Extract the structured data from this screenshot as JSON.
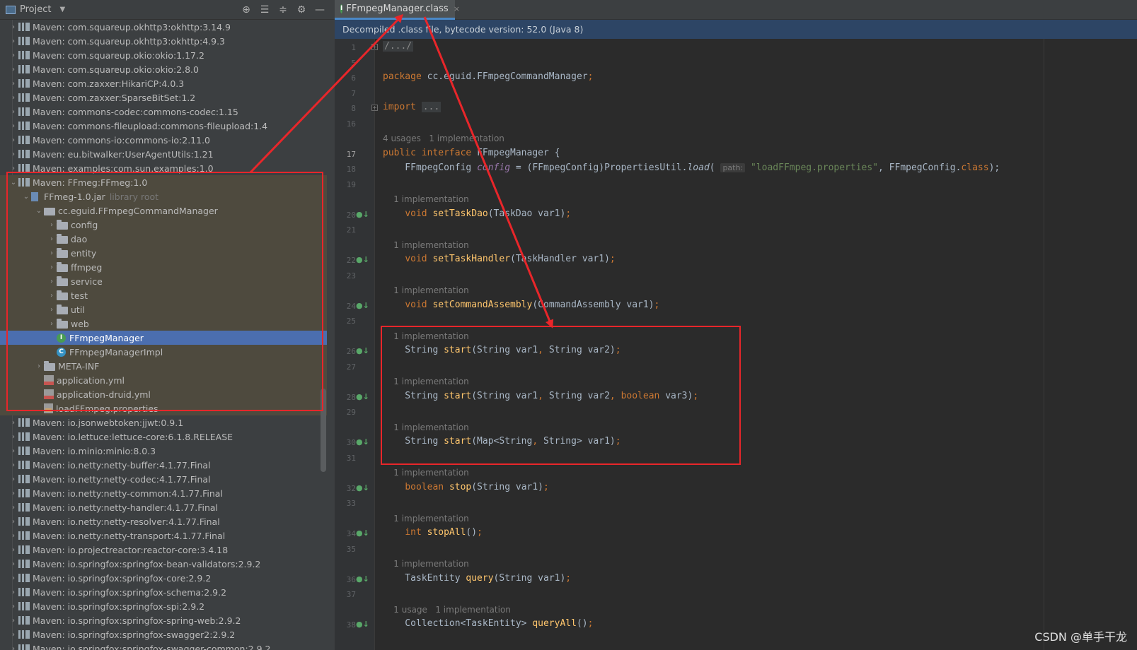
{
  "project_panel": {
    "title": "Project",
    "tools": [
      "locate-icon",
      "expand-all-icon",
      "collapse-all-icon",
      "gear-icon",
      "minimize-icon"
    ],
    "tree": [
      {
        "label": "Maven: com.squareup.okhttp3:okhttp:3.14.9",
        "kind": "lib",
        "depth": 0,
        "expanded": false
      },
      {
        "label": "Maven: com.squareup.okhttp3:okhttp:4.9.3",
        "kind": "lib",
        "depth": 0,
        "expanded": false
      },
      {
        "label": "Maven: com.squareup.okio:okio:1.17.2",
        "kind": "lib",
        "depth": 0,
        "expanded": false
      },
      {
        "label": "Maven: com.squareup.okio:okio:2.8.0",
        "kind": "lib",
        "depth": 0,
        "expanded": false
      },
      {
        "label": "Maven: com.zaxxer:HikariCP:4.0.3",
        "kind": "lib",
        "depth": 0,
        "expanded": false
      },
      {
        "label": "Maven: com.zaxxer:SparseBitSet:1.2",
        "kind": "lib",
        "depth": 0,
        "expanded": false
      },
      {
        "label": "Maven: commons-codec:commons-codec:1.15",
        "kind": "lib",
        "depth": 0,
        "expanded": false
      },
      {
        "label": "Maven: commons-fileupload:commons-fileupload:1.4",
        "kind": "lib",
        "depth": 0,
        "expanded": false
      },
      {
        "label": "Maven: commons-io:commons-io:2.11.0",
        "kind": "lib",
        "depth": 0,
        "expanded": false
      },
      {
        "label": "Maven: eu.bitwalker:UserAgentUtils:1.21",
        "kind": "lib",
        "depth": 0,
        "expanded": false
      },
      {
        "label": "Maven: examples:com.sun.examples:1.0",
        "kind": "lib",
        "depth": 0,
        "expanded": false
      },
      {
        "label": "Maven: FFmeg:FFmeg:1.0",
        "kind": "lib",
        "depth": 0,
        "expanded": true
      },
      {
        "label": "FFmeg-1.0.jar",
        "suffix": "library root",
        "kind": "jar",
        "depth": 1,
        "expanded": true
      },
      {
        "label": "cc.eguid.FFmpegCommandManager",
        "kind": "pkg",
        "depth": 2,
        "expanded": true
      },
      {
        "label": "config",
        "kind": "folder",
        "depth": 3,
        "expanded": false
      },
      {
        "label": "dao",
        "kind": "folder",
        "depth": 3,
        "expanded": false
      },
      {
        "label": "entity",
        "kind": "folder",
        "depth": 3,
        "expanded": false
      },
      {
        "label": "ffmpeg",
        "kind": "folder",
        "depth": 3,
        "expanded": false
      },
      {
        "label": "service",
        "kind": "folder",
        "depth": 3,
        "expanded": false
      },
      {
        "label": "test",
        "kind": "folder",
        "depth": 3,
        "expanded": false
      },
      {
        "label": "util",
        "kind": "folder",
        "depth": 3,
        "expanded": false
      },
      {
        "label": "web",
        "kind": "folder",
        "depth": 3,
        "expanded": false
      },
      {
        "label": "FFmpegManager",
        "kind": "interface",
        "depth": 3,
        "selected": true
      },
      {
        "label": "FFmpegManagerImpl",
        "kind": "class",
        "depth": 3
      },
      {
        "label": "META-INF",
        "kind": "folder",
        "depth": 2,
        "expanded": false
      },
      {
        "label": "application.yml",
        "kind": "yml",
        "depth": 2
      },
      {
        "label": "application-druid.yml",
        "kind": "yml",
        "depth": 2
      },
      {
        "label": "loadFFmpeg.properties",
        "kind": "prop",
        "depth": 2
      },
      {
        "label": "Maven: io.jsonwebtoken:jjwt:0.9.1",
        "kind": "lib",
        "depth": 0,
        "expanded": false
      },
      {
        "label": "Maven: io.lettuce:lettuce-core:6.1.8.RELEASE",
        "kind": "lib",
        "depth": 0,
        "expanded": false
      },
      {
        "label": "Maven: io.minio:minio:8.0.3",
        "kind": "lib",
        "depth": 0,
        "expanded": false
      },
      {
        "label": "Maven: io.netty:netty-buffer:4.1.77.Final",
        "kind": "lib",
        "depth": 0,
        "expanded": false
      },
      {
        "label": "Maven: io.netty:netty-codec:4.1.77.Final",
        "kind": "lib",
        "depth": 0,
        "expanded": false
      },
      {
        "label": "Maven: io.netty:netty-common:4.1.77.Final",
        "kind": "lib",
        "depth": 0,
        "expanded": false
      },
      {
        "label": "Maven: io.netty:netty-handler:4.1.77.Final",
        "kind": "lib",
        "depth": 0,
        "expanded": false
      },
      {
        "label": "Maven: io.netty:netty-resolver:4.1.77.Final",
        "kind": "lib",
        "depth": 0,
        "expanded": false
      },
      {
        "label": "Maven: io.netty:netty-transport:4.1.77.Final",
        "kind": "lib",
        "depth": 0,
        "expanded": false
      },
      {
        "label": "Maven: io.projectreactor:reactor-core:3.4.18",
        "kind": "lib",
        "depth": 0,
        "expanded": false
      },
      {
        "label": "Maven: io.springfox:springfox-bean-validators:2.9.2",
        "kind": "lib",
        "depth": 0,
        "expanded": false
      },
      {
        "label": "Maven: io.springfox:springfox-core:2.9.2",
        "kind": "lib",
        "depth": 0,
        "expanded": false
      },
      {
        "label": "Maven: io.springfox:springfox-schema:2.9.2",
        "kind": "lib",
        "depth": 0,
        "expanded": false
      },
      {
        "label": "Maven: io.springfox:springfox-spi:2.9.2",
        "kind": "lib",
        "depth": 0,
        "expanded": false
      },
      {
        "label": "Maven: io.springfox:springfox-spring-web:2.9.2",
        "kind": "lib",
        "depth": 0,
        "expanded": false
      },
      {
        "label": "Maven: io.springfox:springfox-swagger2:2.9.2",
        "kind": "lib",
        "depth": 0,
        "expanded": false
      },
      {
        "label": "Maven: io.springfox:springfox-swagger-common:2.9.2",
        "kind": "lib",
        "depth": 0,
        "expanded": false
      }
    ]
  },
  "editor": {
    "tab": {
      "label": "FFmpegManager.class",
      "icon": "interface-icon",
      "close": "×"
    },
    "banner": "Decompiled .class file, bytecode version: 52.0 (Java 8)",
    "lines": [
      {
        "n": "1",
        "kind": "code",
        "fold": "+",
        "tokens": [
          {
            "t": "/.../",
            "c": "fold-txt"
          }
        ]
      },
      {
        "n": "5",
        "kind": "blank"
      },
      {
        "n": "6",
        "kind": "code",
        "tokens": [
          {
            "t": "package ",
            "c": "kw"
          },
          {
            "t": "cc.eguid.FFmpegCommandManager"
          },
          {
            "t": ";",
            "c": "kw"
          }
        ]
      },
      {
        "n": "7",
        "kind": "blank"
      },
      {
        "n": "8",
        "kind": "code",
        "fold": "+",
        "tokens": [
          {
            "t": "import ",
            "c": "kw"
          },
          {
            "t": "...",
            "c": "fold-txt"
          }
        ]
      },
      {
        "n": "16",
        "kind": "blank"
      },
      {
        "kind": "hint",
        "text": "4 usages   1 implementation"
      },
      {
        "n": "17",
        "kind": "code",
        "cur": true,
        "tokens": [
          {
            "t": "public interface ",
            "c": "kw"
          },
          {
            "t": "FFmpegManager "
          },
          {
            "t": "{"
          }
        ]
      },
      {
        "n": "18",
        "kind": "code",
        "tokens": [
          {
            "t": "    FFmpegConfig "
          },
          {
            "t": "config",
            "c": "fld"
          },
          {
            "t": " = (FFmpegConfig)PropertiesUtil."
          },
          {
            "t": "load",
            "c": "it"
          },
          {
            "t": "( "
          },
          {
            "t": "path:",
            "c": "param-hint"
          },
          {
            "t": " "
          },
          {
            "t": "\"loadFFmpeg.properties\"",
            "c": "str"
          },
          {
            "t": ", FFmpegConfig."
          },
          {
            "t": "class",
            "c": "kw"
          },
          {
            "t": ");"
          }
        ]
      },
      {
        "n": "19",
        "kind": "blank"
      },
      {
        "kind": "hint",
        "text": "    1 implementation"
      },
      {
        "n": "20",
        "kind": "code",
        "impl": true,
        "tokens": [
          {
            "t": "    "
          },
          {
            "t": "void ",
            "c": "kw"
          },
          {
            "t": "setTaskDao",
            "c": "fn"
          },
          {
            "t": "(TaskDao var1)"
          },
          {
            "t": ";",
            "c": "kw"
          }
        ]
      },
      {
        "n": "21",
        "kind": "blank"
      },
      {
        "kind": "hint",
        "text": "    1 implementation"
      },
      {
        "n": "22",
        "kind": "code",
        "impl": true,
        "tokens": [
          {
            "t": "    "
          },
          {
            "t": "void ",
            "c": "kw"
          },
          {
            "t": "setTaskHandler",
            "c": "fn"
          },
          {
            "t": "(TaskHandler var1)"
          },
          {
            "t": ";",
            "c": "kw"
          }
        ]
      },
      {
        "n": "23",
        "kind": "blank"
      },
      {
        "kind": "hint",
        "text": "    1 implementation"
      },
      {
        "n": "24",
        "kind": "code",
        "impl": true,
        "tokens": [
          {
            "t": "    "
          },
          {
            "t": "void ",
            "c": "kw"
          },
          {
            "t": "setCommandAssembly",
            "c": "fn"
          },
          {
            "t": "(CommandAssembly var1)"
          },
          {
            "t": ";",
            "c": "kw"
          }
        ]
      },
      {
        "n": "25",
        "kind": "blank"
      },
      {
        "kind": "hint",
        "text": "    1 implementation"
      },
      {
        "n": "26",
        "kind": "code",
        "impl": true,
        "tokens": [
          {
            "t": "    String "
          },
          {
            "t": "start",
            "c": "fn"
          },
          {
            "t": "(String var1"
          },
          {
            "t": ", ",
            "c": "kw"
          },
          {
            "t": "String var2)"
          },
          {
            "t": ";",
            "c": "kw"
          }
        ]
      },
      {
        "n": "27",
        "kind": "blank"
      },
      {
        "kind": "hint",
        "text": "    1 implementation"
      },
      {
        "n": "28",
        "kind": "code",
        "impl": true,
        "tokens": [
          {
            "t": "    String "
          },
          {
            "t": "start",
            "c": "fn"
          },
          {
            "t": "(String var1"
          },
          {
            "t": ", ",
            "c": "kw"
          },
          {
            "t": "String var2"
          },
          {
            "t": ", ",
            "c": "kw"
          },
          {
            "t": "boolean ",
            "c": "kw"
          },
          {
            "t": "var3)"
          },
          {
            "t": ";",
            "c": "kw"
          }
        ]
      },
      {
        "n": "29",
        "kind": "blank"
      },
      {
        "kind": "hint",
        "text": "    1 implementation"
      },
      {
        "n": "30",
        "kind": "code",
        "impl": true,
        "tokens": [
          {
            "t": "    String "
          },
          {
            "t": "start",
            "c": "fn"
          },
          {
            "t": "(Map<String"
          },
          {
            "t": ", ",
            "c": "kw"
          },
          {
            "t": "String> var1)"
          },
          {
            "t": ";",
            "c": "kw"
          }
        ]
      },
      {
        "n": "31",
        "kind": "blank"
      },
      {
        "kind": "hint",
        "text": "    1 implementation"
      },
      {
        "n": "32",
        "kind": "code",
        "impl": true,
        "tokens": [
          {
            "t": "    "
          },
          {
            "t": "boolean ",
            "c": "kw"
          },
          {
            "t": "stop",
            "c": "fn"
          },
          {
            "t": "(String var1)"
          },
          {
            "t": ";",
            "c": "kw"
          }
        ]
      },
      {
        "n": "33",
        "kind": "blank"
      },
      {
        "kind": "hint",
        "text": "    1 implementation"
      },
      {
        "n": "34",
        "kind": "code",
        "impl": true,
        "tokens": [
          {
            "t": "    "
          },
          {
            "t": "int ",
            "c": "kw"
          },
          {
            "t": "stopAll",
            "c": "fn"
          },
          {
            "t": "()"
          },
          {
            "t": ";",
            "c": "kw"
          }
        ]
      },
      {
        "n": "35",
        "kind": "blank"
      },
      {
        "kind": "hint",
        "text": "    1 implementation"
      },
      {
        "n": "36",
        "kind": "code",
        "impl": true,
        "tokens": [
          {
            "t": "    TaskEntity "
          },
          {
            "t": "query",
            "c": "fn"
          },
          {
            "t": "(String var1)"
          },
          {
            "t": ";",
            "c": "kw"
          }
        ]
      },
      {
        "n": "37",
        "kind": "blank"
      },
      {
        "kind": "hint",
        "text": "    1 usage   1 implementation"
      },
      {
        "n": "38",
        "kind": "code",
        "impl": true,
        "tokens": [
          {
            "t": "    Collection<TaskEntity> "
          },
          {
            "t": "queryAll",
            "c": "fn"
          },
          {
            "t": "()"
          },
          {
            "t": ";",
            "c": "kw"
          }
        ]
      }
    ]
  },
  "annotation_color": "#e8262a",
  "watermark": "CSDN @单手干龙"
}
